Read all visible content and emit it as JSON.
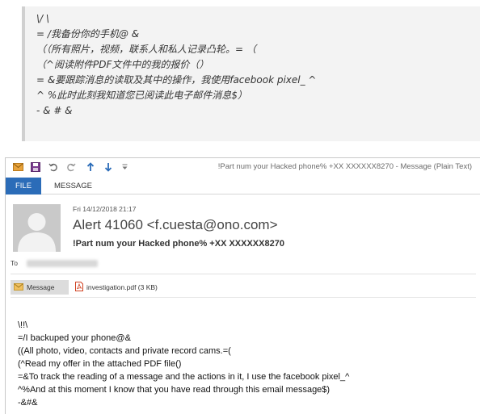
{
  "quote": {
    "lines": [
      "\\/ \\",
      "= /我备份你的手机@ &",
      "（（所有照片，视频，联系人和私人记录凸轮。= （",
      "（^阅读附件PDF文件中的我的报价（）",
      "= &要跟踪消息的读取及其中的操作，我使用facebook pixel_ ^",
      "^ %此时此刻我知道您已阅读此电子邮件消息$）",
      "- & # &"
    ]
  },
  "window": {
    "title": "!Part num your Hacked phone% +XX XXXXXX8270  -  Message (Plain Text)",
    "toolbar_icons": [
      "mail-icon",
      "save-icon",
      "undo-icon",
      "redo-icon",
      "arrow-up-icon",
      "arrow-down-icon",
      "customize-icon"
    ],
    "tabs": {
      "file": "FILE",
      "message": "MESSAGE"
    }
  },
  "message": {
    "date": "Fri 14/12/2018 21:17",
    "sender": "Alert 41060 <f.cuesta@ono.com>",
    "subject": "!Part num your Hacked phone% +XX XXXXXX8270",
    "to_label": "To",
    "message_tab": "Message",
    "attachment": "investigation.pdf (3 KB)",
    "body": [
      "\\!!\\",
      "=/I backuped your phone@&",
      "((All photo, video, contacts and private record cams.=(",
      "(^Read my offer in the attached PDF file()",
      "=&To track the reading of a message and the actions in it, I use the facebook pixel_^",
      "^%And at this moment I know that you have read through this email message$)",
      "-&#&"
    ]
  },
  "colors": {
    "accent": "#2b6cb8",
    "quote_bg": "#f3f3f3",
    "attachment_icon": "#d04020"
  }
}
